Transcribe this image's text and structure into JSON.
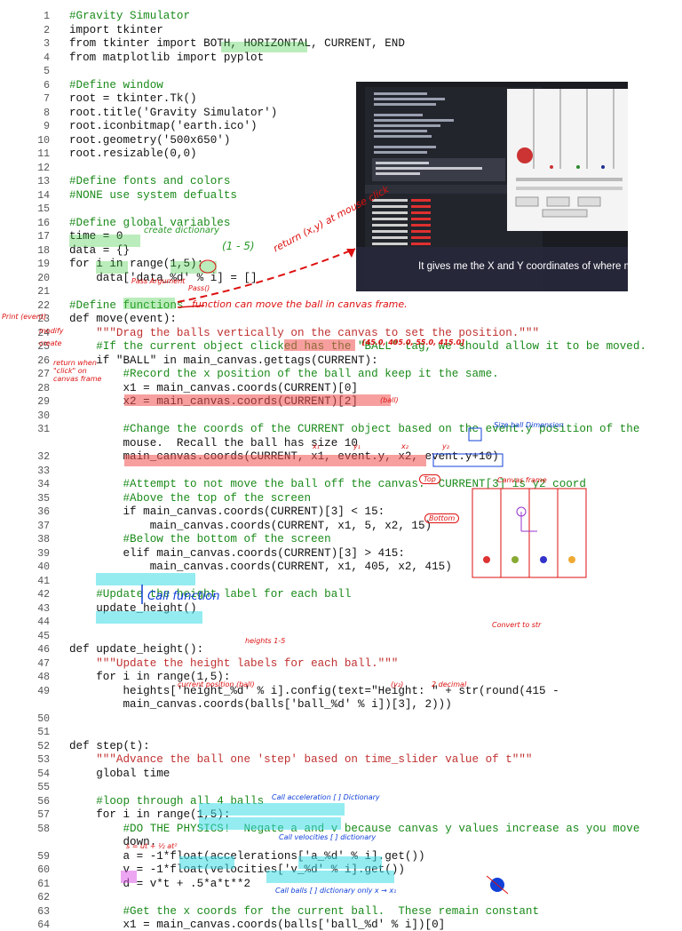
{
  "code_lines": [
    {
      "n": "1",
      "t": "#Gravity Simulator"
    },
    {
      "n": "2",
      "t": "import tkinter"
    },
    {
      "n": "3",
      "t": "from tkinter import BOTH, HORIZONTAL, CURRENT, END"
    },
    {
      "n": "4",
      "t": "from matplotlib import pyplot"
    },
    {
      "n": "5",
      "t": ""
    },
    {
      "n": "6",
      "t": "#Define window"
    },
    {
      "n": "7",
      "t": "root = tkinter.Tk()"
    },
    {
      "n": "8",
      "t": "root.title('Gravity Simulator')"
    },
    {
      "n": "9",
      "t": "root.iconbitmap('earth.ico')"
    },
    {
      "n": "10",
      "t": "root.geometry('500x650')"
    },
    {
      "n": "11",
      "t": "root.resizable(0,0)"
    },
    {
      "n": "12",
      "t": ""
    },
    {
      "n": "13",
      "t": "#Define fonts and colors"
    },
    {
      "n": "14",
      "t": "#NONE use system defualts"
    },
    {
      "n": "15",
      "t": ""
    },
    {
      "n": "16",
      "t": "#Define global variables"
    },
    {
      "n": "17",
      "t": "time = 0"
    },
    {
      "n": "18",
      "t": "data = {}"
    },
    {
      "n": "19",
      "t": "for i in range(1,5):"
    },
    {
      "n": "20",
      "t": "    data['data_%d' % i] = []"
    },
    {
      "n": "21",
      "t": ""
    },
    {
      "n": "22",
      "t": "#Define functions"
    },
    {
      "n": "23",
      "t": "def move(event):"
    },
    {
      "n": "24",
      "t": "    \"\"\"Drag the balls vertically on the canvas to set the position.\"\"\""
    },
    {
      "n": "25",
      "t": "    #If the current object clicked has the \"BALL\" tag, we should allow it to be moved."
    },
    {
      "n": "26",
      "t": "    if \"BALL\" in main_canvas.gettags(CURRENT):"
    },
    {
      "n": "27",
      "t": "        #Record the x position of the ball and keep it the same."
    },
    {
      "n": "28",
      "t": "        x1 = main_canvas.coords(CURRENT)[0]"
    },
    {
      "n": "29",
      "t": "        x2 = main_canvas.coords(CURRENT)[2]"
    },
    {
      "n": "30",
      "t": ""
    },
    {
      "n": "31",
      "t": "        #Change the coords of the CURRENT object based on the event.y position of the"
    },
    {
      "n": "",
      "t": "        mouse.  Recall the ball has size 10"
    },
    {
      "n": "32",
      "t": "        main_canvas.coords(CURRENT, x1, event.y, x2, event.y+10)"
    },
    {
      "n": "33",
      "t": ""
    },
    {
      "n": "34",
      "t": "        #Attempt to not move the ball off the canvas.  CURRENT[3] is y2 coord"
    },
    {
      "n": "35",
      "t": "        #Above the top of the screen"
    },
    {
      "n": "36",
      "t": "        if main_canvas.coords(CURRENT)[3] < 15:"
    },
    {
      "n": "37",
      "t": "            main_canvas.coords(CURRENT, x1, 5, x2, 15)"
    },
    {
      "n": "38",
      "t": "        #Below the bottom of the screen"
    },
    {
      "n": "39",
      "t": "        elif main_canvas.coords(CURRENT)[3] > 415:"
    },
    {
      "n": "40",
      "t": "            main_canvas.coords(CURRENT, x1, 405, x2, 415)"
    },
    {
      "n": "41",
      "t": ""
    },
    {
      "n": "42",
      "t": "    #Update the height label for each ball"
    },
    {
      "n": "43",
      "t": "    update_height()"
    },
    {
      "n": "44",
      "t": ""
    },
    {
      "n": "45",
      "t": ""
    },
    {
      "n": "46",
      "t": "def update_height():"
    },
    {
      "n": "47",
      "t": "    \"\"\"Update the height labels for each ball.\"\"\""
    },
    {
      "n": "48",
      "t": "    for i in range(1,5):"
    },
    {
      "n": "49",
      "t": "        heights['height_%d' % i].config(text=\"Height: \" + str(round(415 -"
    },
    {
      "n": "",
      "t": "        main_canvas.coords(balls['ball_%d' % i])[3], 2)))"
    },
    {
      "n": "50",
      "t": ""
    },
    {
      "n": "51",
      "t": ""
    },
    {
      "n": "52",
      "t": "def step(t):"
    },
    {
      "n": "53",
      "t": "    \"\"\"Advance the ball one 'step' based on time_slider value of t\"\"\""
    },
    {
      "n": "54",
      "t": "    global time"
    },
    {
      "n": "55",
      "t": ""
    },
    {
      "n": "56",
      "t": "    #loop through all 4 balls"
    },
    {
      "n": "57",
      "t": "    for i in range(1,5):"
    },
    {
      "n": "58",
      "t": "        #DO THE PHYSICS!  Negate a and v because canvas y values increase as you move"
    },
    {
      "n": "",
      "t": "        down."
    },
    {
      "n": "59",
      "t": "        a = -1*float(accelerations['a_%d' % i].get())"
    },
    {
      "n": "60",
      "t": "        v = -1*float(velocities['v_%d' % i].get())"
    },
    {
      "n": "61",
      "t": "        d = v*t + .5*a*t**2"
    },
    {
      "n": "62",
      "t": ""
    },
    {
      "n": "63",
      "t": "        #Get the x coords for the current ball.  These remain constant"
    },
    {
      "n": "64",
      "t": "        x1 = main_canvas.coords(balls['ball_%d' % i])[0]"
    }
  ],
  "annotations": {
    "create_dictionary": "create dictionary",
    "range_note": "(1 - 5)",
    "return_xy": "return (x,y) at mouse click",
    "pass_argument": "Pass Argument",
    "pass_o": "Pass()",
    "function_can_move": "function can move the ball in canvas frame.",
    "print_event": "Print (event)",
    "modify": "modify",
    "create": "create",
    "return_when_click": "return when \"click\" on canvas frame",
    "coords_values": "[45.0, 405.0, 55.0, 415.0]",
    "ball": "(ball)",
    "size_ball": "Size ball Dimension",
    "x1": "x₁",
    "y1": "y₁",
    "x2": "x₂",
    "y2": "y₂",
    "top": "Top",
    "bottom": "Bottom",
    "canvas_frame": "Canvas frame",
    "call_function": "Call function",
    "heights": "heights 1-5",
    "convert_to_str": "Convert to str",
    "current_position": "current position (ball)",
    "y2_note": "(y₂)",
    "decimal": "2 decimal",
    "call_accel": "Call acceleration [ ] Dictionary",
    "call_vel": "Call velocities [ ] dictionary",
    "call_balls": "Call balls [ ] dictionary only x → x₁",
    "s_formula": "s = ut + ½ at²",
    "photo_caption": "It gives me the X and Y coordinates of where my"
  },
  "colors": {
    "red_ink": "#dd1111",
    "blue_ink": "#1040d8",
    "red_highlight": "#f05050",
    "cyan_highlight": "#3cdce6",
    "green_highlight": "#3cc83c"
  }
}
